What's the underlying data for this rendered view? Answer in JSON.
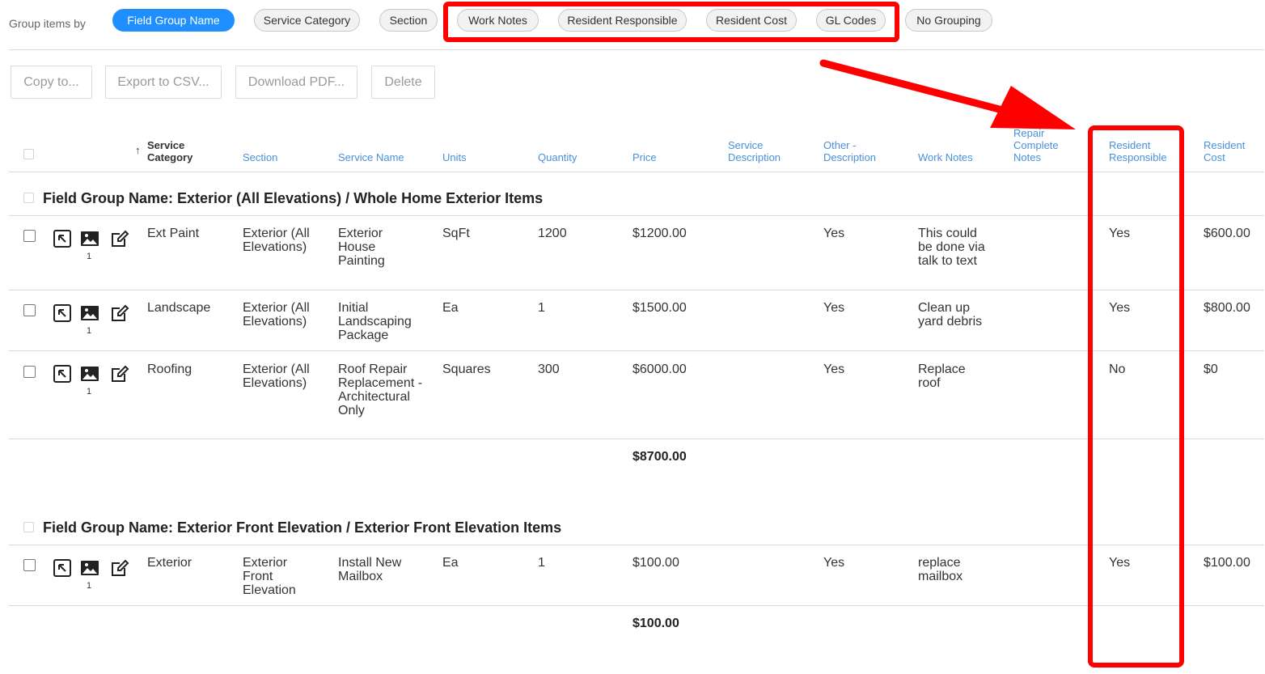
{
  "group_by": {
    "label": "Group items by",
    "options": [
      {
        "label": "Field Group Name",
        "active": true
      },
      {
        "label": "Service Category",
        "active": false
      },
      {
        "label": "Section",
        "active": false
      },
      {
        "label": "Work Notes",
        "active": false
      },
      {
        "label": "Resident Responsible",
        "active": false
      },
      {
        "label": "Resident Cost",
        "active": false
      },
      {
        "label": "GL Codes",
        "active": false
      },
      {
        "label": "No Grouping",
        "active": false
      }
    ]
  },
  "actions": {
    "copy": "Copy to...",
    "export_csv": "Export to CSV...",
    "download_pdf": "Download PDF...",
    "delete": "Delete"
  },
  "columns": {
    "service_category": "Service Category",
    "section": "Section",
    "service_name": "Service Name",
    "units": "Units",
    "quantity": "Quantity",
    "price": "Price",
    "service_description": "Service Description",
    "other_description": "Other - Description",
    "work_notes": "Work Notes",
    "repair_complete_notes": "Repair Complete Notes",
    "resident_responsible": "Resident Responsible",
    "resident_cost": "Resident Cost"
  },
  "groups": [
    {
      "title": "Field Group Name: Exterior (All Elevations) / Whole Home Exterior Items",
      "total": "$8700.00",
      "rows": [
        {
          "photo_count": "1",
          "service_category": "Ext Paint",
          "section": "Exterior (All Elevations)",
          "service_name": "Exterior House Painting",
          "units": "SqFt",
          "quantity": "1200",
          "price": "$1200.00",
          "other_description": "Yes",
          "work_notes": "This could be done via talk to text",
          "resident_responsible": "Yes",
          "resident_cost": "$600.00"
        },
        {
          "photo_count": "1",
          "service_category": "Landscape",
          "section": "Exterior (All Elevations)",
          "service_name": "Initial Landscaping Package",
          "units": "Ea",
          "quantity": "1",
          "price": "$1500.00",
          "other_description": "Yes",
          "work_notes": "Clean up yard debris",
          "resident_responsible": "Yes",
          "resident_cost": "$800.00"
        },
        {
          "photo_count": "1",
          "service_category": "Roofing",
          "section": "Exterior (All Elevations)",
          "service_name": "Roof Repair Replacement - Architectural Only",
          "units": "Squares",
          "quantity": "300",
          "price": "$6000.00",
          "other_description": "Yes",
          "work_notes": "Replace roof",
          "resident_responsible": "No",
          "resident_cost": "$0"
        }
      ]
    },
    {
      "title": "Field Group Name: Exterior Front Elevation / Exterior Front Elevation Items",
      "total": "$100.00",
      "rows": [
        {
          "photo_count": "1",
          "service_category": "Exterior",
          "section": "Exterior Front Elevation",
          "service_name": "Install New Mailbox",
          "units": "Ea",
          "quantity": "1",
          "price": "$100.00",
          "other_description": "Yes",
          "work_notes": "replace mailbox",
          "resident_responsible": "Yes",
          "resident_cost": "$100.00"
        }
      ]
    }
  ],
  "colors": {
    "accent": "#1f8fff",
    "header_text": "#4a90d9",
    "annotation": "#ff0000"
  }
}
